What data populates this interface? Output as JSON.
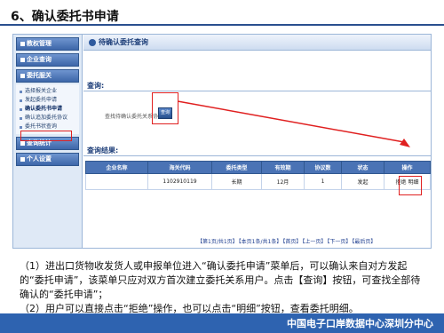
{
  "slide": {
    "title": "6、确认委托书申请",
    "footer": "中国电子口岸数据中心深圳分中心"
  },
  "sidebar": {
    "sections": [
      {
        "label": "教权管理"
      },
      {
        "label": "企业查询"
      },
      {
        "label": "委托服关"
      }
    ],
    "items": [
      {
        "label": "选择报关企业"
      },
      {
        "label": "发起委托申请"
      },
      {
        "label": "确认委托书申请"
      },
      {
        "label": "确认追加委托协议"
      },
      {
        "label": "委托书状查询"
      }
    ],
    "sections2": [
      {
        "label": "查询统计"
      },
      {
        "label": "个人设置"
      }
    ]
  },
  "main": {
    "header": "待确认委托查询",
    "query_label": "查询:",
    "query_field_label": "查找待确认委托关系协议",
    "query_button": "查询",
    "results_label": "查询结果:",
    "table": {
      "columns": [
        "企业名称",
        "海关代码",
        "委托类型",
        "有效期",
        "协议数",
        "状态",
        "操作"
      ],
      "rows": [
        [
          "",
          "1102910119",
          "长期",
          "12月",
          "1",
          "发起",
          "拒绝 明细"
        ]
      ]
    },
    "pager": [
      "【第1页/共1页】",
      "【本页1条/共1条】",
      "【首页】",
      "【上一页】",
      "【下一页】",
      "【最后页】"
    ]
  },
  "description": [
    "（1）进出口货物收发货人或申报单位进入“确认委托申请”菜单后，可以确认来自对方发起的“委托申请”，该菜单只应对双方首次建立委托关系用户。点击【查询】按钮，可查找全部待确认的“委托申请”；",
    "（2）用户可以直接点击“拒绝”操作，也可以点击“明细”按钮，查看委托明细。"
  ],
  "colors": {
    "accent": "#2e63b0",
    "highlight": "#e02020",
    "table_header": "#4a73b5"
  }
}
